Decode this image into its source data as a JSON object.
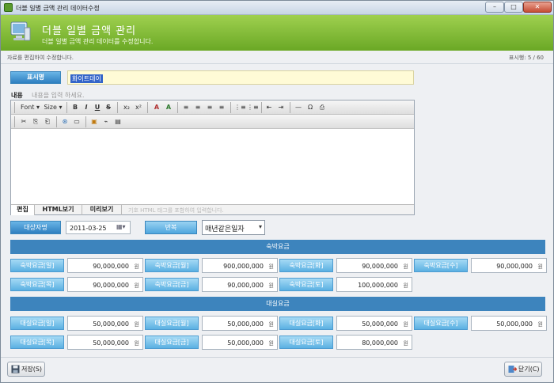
{
  "window": {
    "title": "더블 일별 금액 관리 데이터수정",
    "min": "–",
    "max": "□",
    "close": "✕"
  },
  "banner": {
    "title": "더블 일별 금액 관리",
    "subtitle": "더블 일별 금액 관리 데이터를 수정합니다.",
    "color": "#7bb834"
  },
  "info": {
    "left": "자료를 편집하여 수정합니다.",
    "right": "표시행: 5 / 60"
  },
  "display": {
    "label": "표시명",
    "value": "화이트데이"
  },
  "content": {
    "label": "내용",
    "placeholder": "내용을 입력 하세요."
  },
  "toolbar1": [
    "Font ▾",
    "Size ▾",
    "B",
    "I",
    "U",
    "S",
    "x₂",
    "x²",
    "A",
    "A",
    "≡",
    "≡",
    "≡",
    "≡",
    "⋮≡",
    "⋮≡",
    "⇤",
    "⇥",
    "—",
    "Ω",
    "⎙"
  ],
  "toolbar2": [
    "✂",
    "⎘",
    "⎗",
    "⊛",
    "▭",
    "▣",
    "⌁",
    "▤"
  ],
  "editor_tabs": {
    "edit": "편집",
    "html": "HTML보기",
    "preview": "미리보기",
    "hint": "기호 HTML 태그를 포함하여 입력합니다."
  },
  "date": {
    "label": "대상자명",
    "value": "2011-03-25",
    "btn": "▦▾"
  },
  "repeat": {
    "label": "반복",
    "value": "매년같은일자",
    "arrow": "▾"
  },
  "lodging": {
    "title": "숙박요금",
    "fields": [
      {
        "label": "숙박요금[일]",
        "value": "90,000,000",
        "unit": "원"
      },
      {
        "label": "숙박요금[월]",
        "value": "900,000,000",
        "unit": "원"
      },
      {
        "label": "숙박요금[화]",
        "value": "90,000,000",
        "unit": "원"
      },
      {
        "label": "숙박요금[수]",
        "value": "90,000,000",
        "unit": "원"
      },
      {
        "label": "숙박요금[목]",
        "value": "90,000,000",
        "unit": "원"
      },
      {
        "label": "숙박요금[금]",
        "value": "90,000,000",
        "unit": "원"
      },
      {
        "label": "숙박요금[토]",
        "value": "100,000,000",
        "unit": "원"
      }
    ]
  },
  "rent": {
    "title": "대실요금",
    "fields": [
      {
        "label": "대실요금[일]",
        "value": "50,000,000",
        "unit": "원"
      },
      {
        "label": "대실요금[월]",
        "value": "50,000,000",
        "unit": "원"
      },
      {
        "label": "대실요금[화]",
        "value": "50,000,000",
        "unit": "원"
      },
      {
        "label": "대실요금[수]",
        "value": "50,000,000",
        "unit": "원"
      },
      {
        "label": "대실요금[목]",
        "value": "50,000,000",
        "unit": "원"
      },
      {
        "label": "대실요금[금]",
        "value": "50,000,000",
        "unit": "원"
      },
      {
        "label": "대실요금[토]",
        "value": "80,000,000",
        "unit": "원"
      }
    ]
  },
  "buttons": {
    "save": "저장(S)",
    "close": "닫기(C)"
  }
}
